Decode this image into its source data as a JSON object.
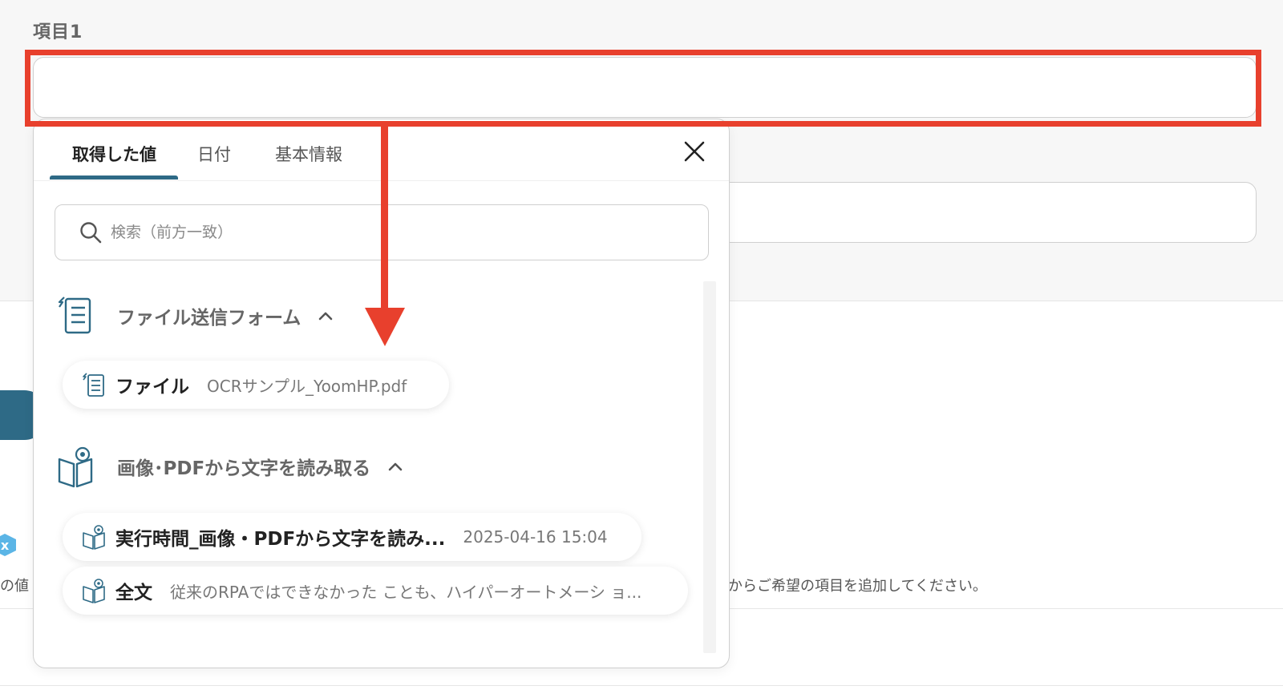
{
  "field": {
    "label": "項目1",
    "value": ""
  },
  "background": {
    "fragment_text": "の値",
    "helper_text": "からご希望の項目を追加してください。",
    "badge_text": "x"
  },
  "popup": {
    "tabs": [
      {
        "label": "取得した値",
        "active": true
      },
      {
        "label": "日付",
        "active": false
      },
      {
        "label": "基本情報",
        "active": false
      }
    ],
    "search": {
      "placeholder": "検索（前方一致）",
      "value": ""
    },
    "sections": [
      {
        "title": "ファイル送信フォーム",
        "icon": "form-icon",
        "expanded": true,
        "items": [
          {
            "title": "ファイル",
            "value": "OCRサンプル_YoomHP.pdf"
          }
        ]
      },
      {
        "title": "画像･PDFから文字を読み取る",
        "icon": "ocr-book-icon",
        "expanded": true,
        "items": [
          {
            "title": "実行時間_画像・PDFから文字を読み...",
            "value": "2025-04-16 15:04"
          },
          {
            "title": "全文",
            "value": "従来のRPAではできなかった ことも、ハイパーオートメーシ ョ..."
          }
        ]
      }
    ]
  },
  "colors": {
    "highlight": "#e8402d",
    "accent": "#2e6a86"
  }
}
